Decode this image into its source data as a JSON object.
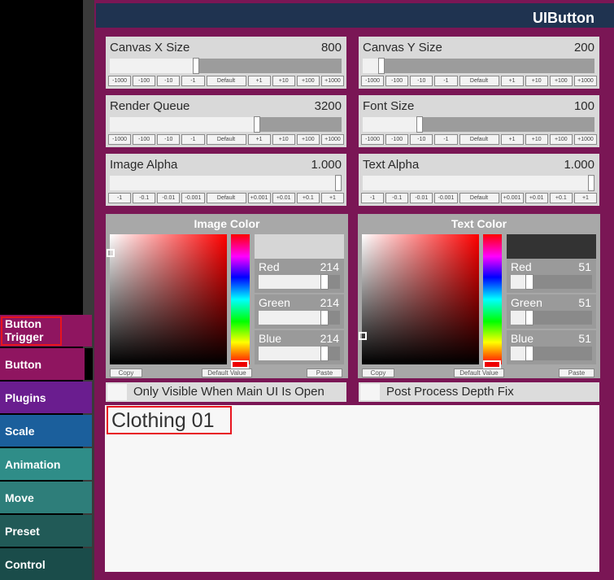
{
  "window": {
    "title": "UIButton"
  },
  "nav": {
    "items": [
      {
        "label": "Button Trigger",
        "color": "#8f1560"
      },
      {
        "label": "Button",
        "color": "#8f1560"
      },
      {
        "label": "Plugins",
        "color": "#6a1d8f"
      },
      {
        "label": "Scale",
        "color": "#1b5f9c"
      },
      {
        "label": "Animation",
        "color": "#2f8d88"
      },
      {
        "label": "Move",
        "color": "#2e7e7a"
      },
      {
        "label": "Preset",
        "color": "#215a57"
      },
      {
        "label": "Control",
        "color": "#1a4c4a"
      }
    ],
    "highlighted": "Button Trigger"
  },
  "sliders": [
    {
      "label": "Canvas X Size",
      "value": "800",
      "fraction": 0.37,
      "steps": [
        "-1000",
        "-100",
        "-10",
        "-1",
        "Default",
        "+1",
        "+10",
        "+100",
        "+1000"
      ]
    },
    {
      "label": "Canvas Y Size",
      "value": "200",
      "fraction": 0.07,
      "steps": [
        "-1000",
        "-100",
        "-10",
        "-1",
        "Default",
        "+1",
        "+10",
        "+100",
        "+1000"
      ]
    },
    {
      "label": "Render Queue",
      "value": "3200",
      "fraction": 0.64,
      "steps": [
        "-1000",
        "-100",
        "-10",
        "-1",
        "Default",
        "+1",
        "+10",
        "+100",
        "+1000"
      ]
    },
    {
      "label": "Font Size",
      "value": "100",
      "fraction": 0.24,
      "steps": [
        "-1000",
        "-100",
        "-10",
        "-1",
        "Default",
        "+1",
        "+10",
        "+100",
        "+1000"
      ]
    },
    {
      "label": "Image Alpha",
      "value": "1.000",
      "fraction": 1.0,
      "steps": [
        "-1",
        "-0.1",
        "-0.01",
        "-0.001",
        "Default",
        "+0.001",
        "+0.01",
        "+0.1",
        "+1"
      ]
    },
    {
      "label": "Text Alpha",
      "value": "1.000",
      "fraction": 1.0,
      "steps": [
        "-1",
        "-0.1",
        "-0.01",
        "-0.001",
        "Default",
        "+0.001",
        "+0.01",
        "+0.1",
        "+1"
      ]
    }
  ],
  "color_pickers": [
    {
      "title": "Image Color",
      "swatch": "#d6d6d6",
      "channels": [
        {
          "label": "Red",
          "value": "214",
          "fraction": 0.84
        },
        {
          "label": "Green",
          "value": "214",
          "fraction": 0.84
        },
        {
          "label": "Blue",
          "value": "214",
          "fraction": 0.84
        }
      ],
      "buttons": {
        "copy": "Copy",
        "default": "Default Value",
        "paste": "Paste"
      }
    },
    {
      "title": "Text Color",
      "swatch": "#333333",
      "channels": [
        {
          "label": "Red",
          "value": "51",
          "fraction": 0.2
        },
        {
          "label": "Green",
          "value": "51",
          "fraction": 0.2
        },
        {
          "label": "Blue",
          "value": "51",
          "fraction": 0.2
        }
      ],
      "buttons": {
        "copy": "Copy",
        "default": "Default Value",
        "paste": "Paste"
      }
    }
  ],
  "toggles": [
    {
      "label": "Only Visible When Main UI Is Open",
      "checked": false
    },
    {
      "label": "Post Process Depth Fix",
      "checked": false
    }
  ],
  "text_input": {
    "value": "Clothing 01"
  },
  "colors": {
    "accent": "#7a1655",
    "header": "#1f3350",
    "highlight": "#e8141e"
  }
}
